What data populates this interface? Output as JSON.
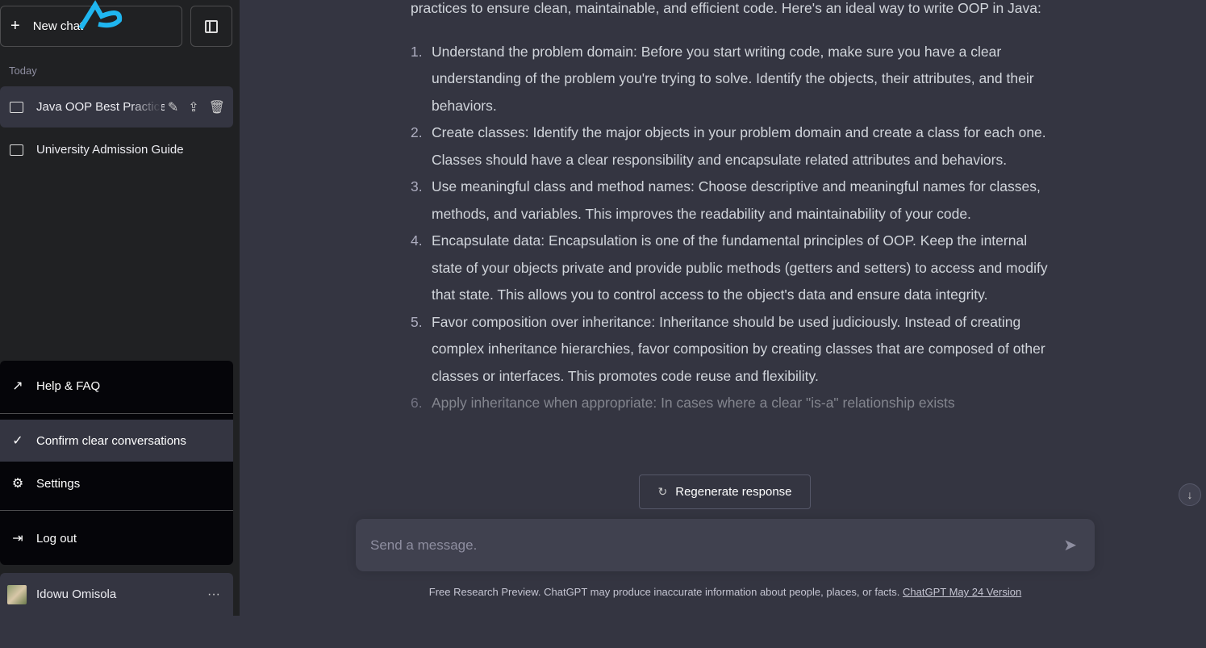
{
  "sidebar": {
    "new_chat": "New chat",
    "section": "Today",
    "chats": [
      {
        "title": "Java OOP Best Practices"
      },
      {
        "title": "University Admission Guide"
      }
    ],
    "menu": {
      "help": "Help & FAQ",
      "confirm": "Confirm clear conversations",
      "settings": "Settings",
      "logout": "Log out"
    },
    "user": {
      "name": "Idowu Omisola"
    },
    "watermark": "AP"
  },
  "main": {
    "intro": "practices to ensure clean, maintainable, and efficient code. Here's an ideal way to write OOP in Java:",
    "items": [
      {
        "n": "1.",
        "text": "Understand the problem domain: Before you start writing code, make sure you have a clear understanding of the problem you're trying to solve. Identify the objects, their attributes, and their behaviors."
      },
      {
        "n": "2.",
        "text": "Create classes: Identify the major objects in your problem domain and create a class for each one. Classes should have a clear responsibility and encapsulate related attributes and behaviors."
      },
      {
        "n": "3.",
        "text": "Use meaningful class and method names: Choose descriptive and meaningful names for classes, methods, and variables. This improves the readability and maintainability of your code."
      },
      {
        "n": "4.",
        "text": "Encapsulate data: Encapsulation is one of the fundamental principles of OOP. Keep the internal state of your objects private and provide public methods (getters and setters) to access and modify that state. This allows you to control access to the object's data and ensure data integrity."
      },
      {
        "n": "5.",
        "text": "Favor composition over inheritance: Inheritance should be used judiciously. Instead of creating complex inheritance hierarchies, favor composition by creating classes that are composed of other classes or interfaces. This promotes code reuse and flexibility."
      },
      {
        "n": "6.",
        "text": "Apply inheritance when appropriate: In cases where a clear \"is-a\" relationship exists"
      }
    ],
    "regenerate": "Regenerate response",
    "input_placeholder": "Send a message.",
    "footer": "Free Research Preview. ChatGPT may produce inaccurate information about people, places, or facts.",
    "footer_link": "ChatGPT May 24 Version"
  }
}
